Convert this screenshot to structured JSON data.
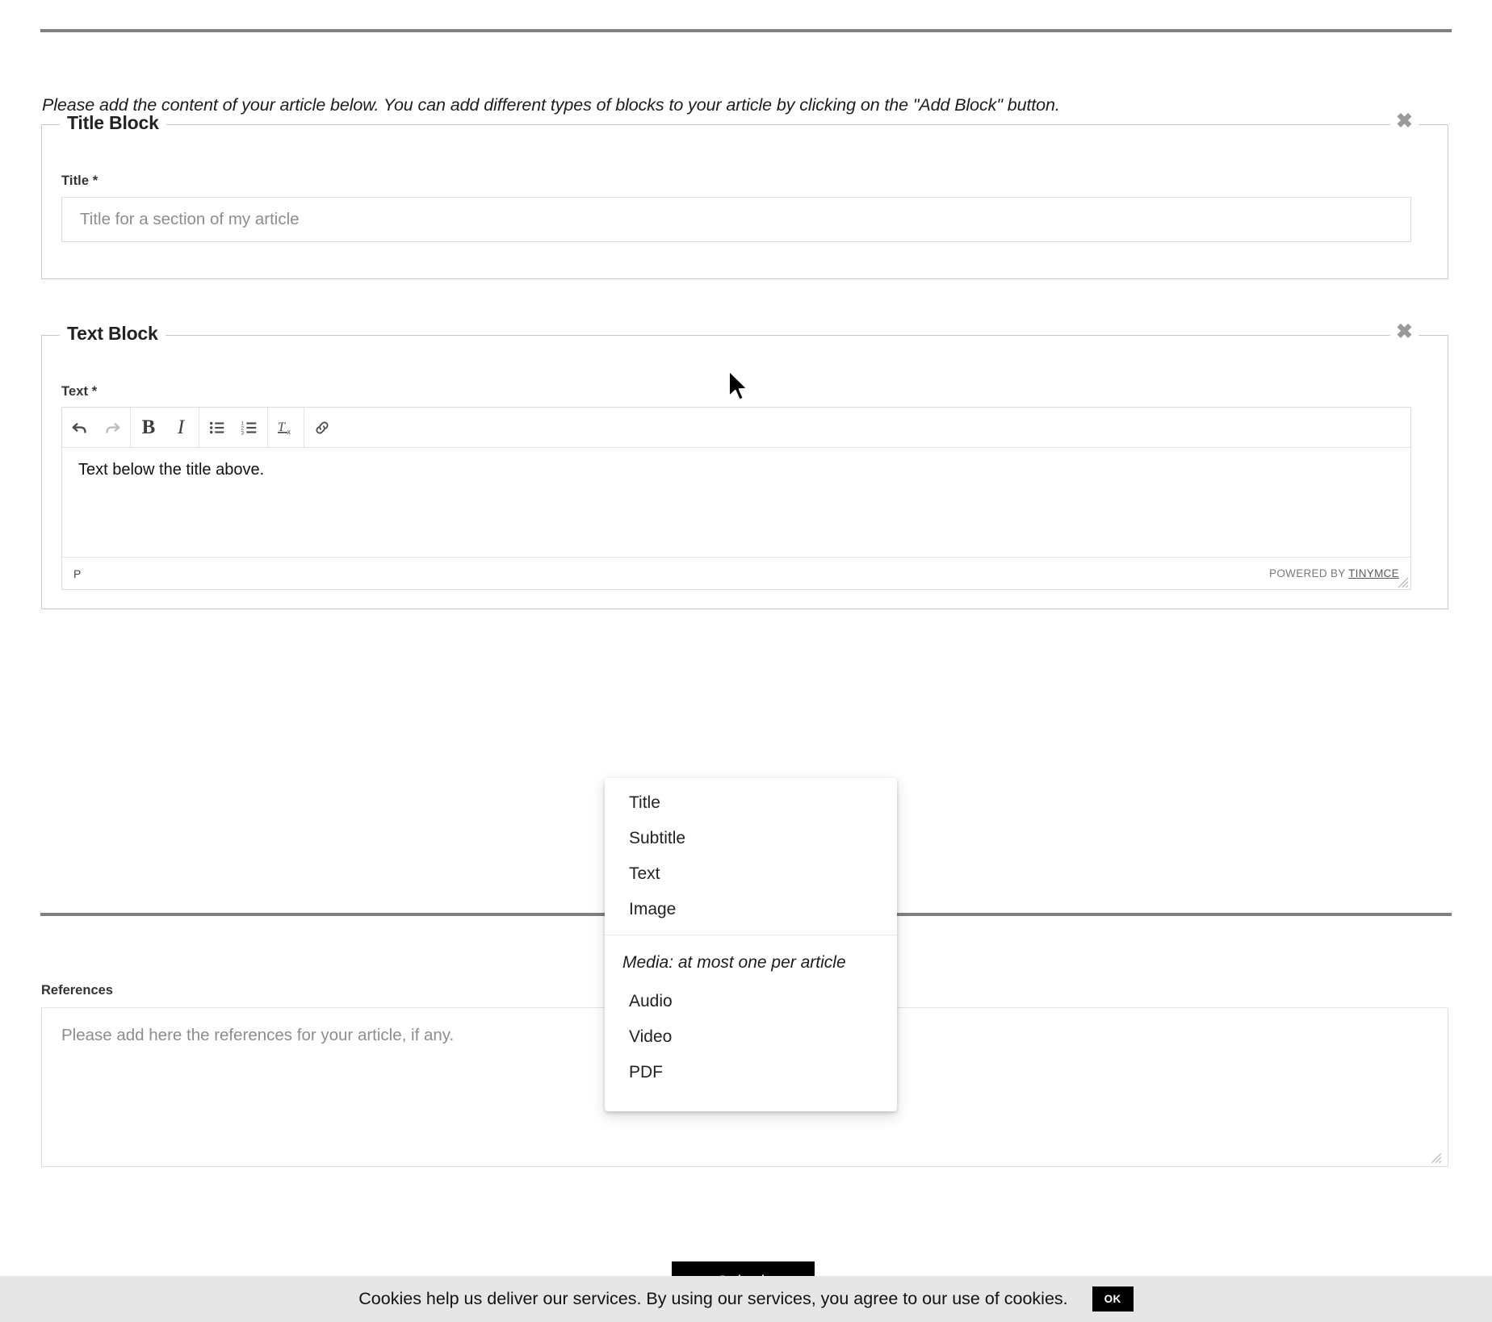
{
  "intro": {
    "text": "Please add the content of your article below. You can add different types of blocks to your article by clicking on the \"Add Block\" button."
  },
  "blocks": [
    {
      "legend": "Title Block",
      "close_label": "✖",
      "field_label": "Title *",
      "input_placeholder": "Title for a section of my article",
      "input_value": ""
    },
    {
      "legend": "Text Block",
      "close_label": "✖",
      "field_label": "Text *",
      "editor_content": "Text below the title above.",
      "status_path": "P",
      "status_brand_prefix": "POWERED BY",
      "status_brand_link": "TINYMCE",
      "toolbar": [
        {
          "name": "undo-icon",
          "title": "Undo",
          "state": "enabled"
        },
        {
          "name": "redo-icon",
          "title": "Redo",
          "state": "disabled"
        },
        {
          "name": "bold-icon",
          "title": "Bold",
          "label": "B",
          "state": "enabled"
        },
        {
          "name": "italic-icon",
          "title": "Italic",
          "label": "I",
          "state": "enabled"
        },
        {
          "name": "bullet-list-icon",
          "title": "Bullet list",
          "state": "enabled"
        },
        {
          "name": "numbered-list-icon",
          "title": "Numbered list",
          "state": "enabled"
        },
        {
          "name": "clear-formatting-icon",
          "title": "Clear formatting",
          "state": "enabled"
        },
        {
          "name": "link-icon",
          "title": "Insert/edit link",
          "state": "enabled"
        }
      ]
    }
  ],
  "add_block_menu": {
    "items": [
      "Title",
      "Subtitle",
      "Text",
      "Image"
    ],
    "media_header": "Media: at most one per article",
    "media_items": [
      "Audio",
      "Video",
      "PDF"
    ]
  },
  "references": {
    "label": "References",
    "placeholder": "Please add here the references for your article, if any.",
    "value": ""
  },
  "submit": {
    "label": "Submit"
  },
  "cookie_banner": {
    "text": "Cookies help us deliver our services. By using our services, you agree to our use of cookies.",
    "ok_label": "OK"
  },
  "colors": {
    "rule": "#808080",
    "border": "#dcdcdc",
    "placeholder": "#8d8d8d",
    "accent_black": "#000000",
    "cookie_bg": "#e6e6e6"
  }
}
